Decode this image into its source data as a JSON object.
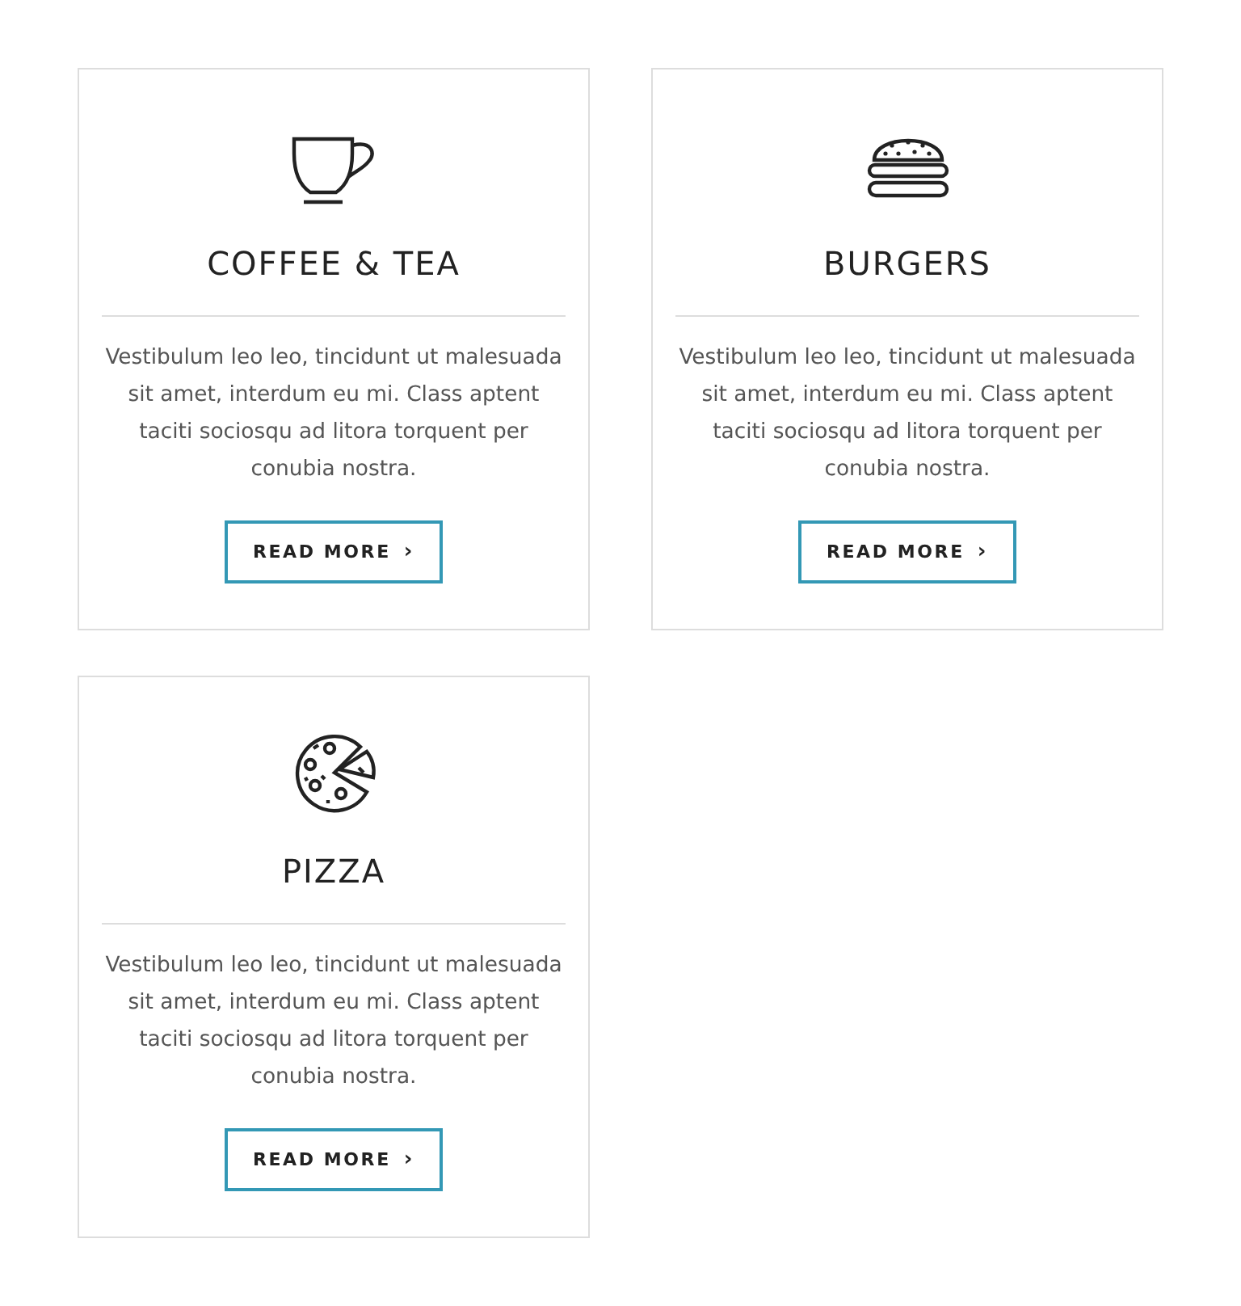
{
  "cards": [
    {
      "kind": "cup",
      "title": "COFFEE & TEA",
      "text": "Vestibulum leo leo, tincidunt ut malesuada sit amet, interdum eu mi. Class aptent taciti sociosqu ad litora torquent per conubia nostra.",
      "button": "READ MORE",
      "button_icon": "›"
    },
    {
      "kind": "burger",
      "title": "BURGERS",
      "text": "Vestibulum leo leo, tincidunt ut malesuada sit amet, interdum eu mi. Class aptent taciti sociosqu ad litora torquent per conubia nostra.",
      "button": "READ MORE",
      "button_icon": "›"
    },
    {
      "kind": "pizza",
      "title": "PIZZA",
      "text": "Vestibulum leo leo, tincidunt ut malesuada sit amet, interdum eu mi. Class aptent taciti sociosqu ad litora torquent per conubia nostra.",
      "button": "READ MORE",
      "button_icon": "›"
    }
  ]
}
